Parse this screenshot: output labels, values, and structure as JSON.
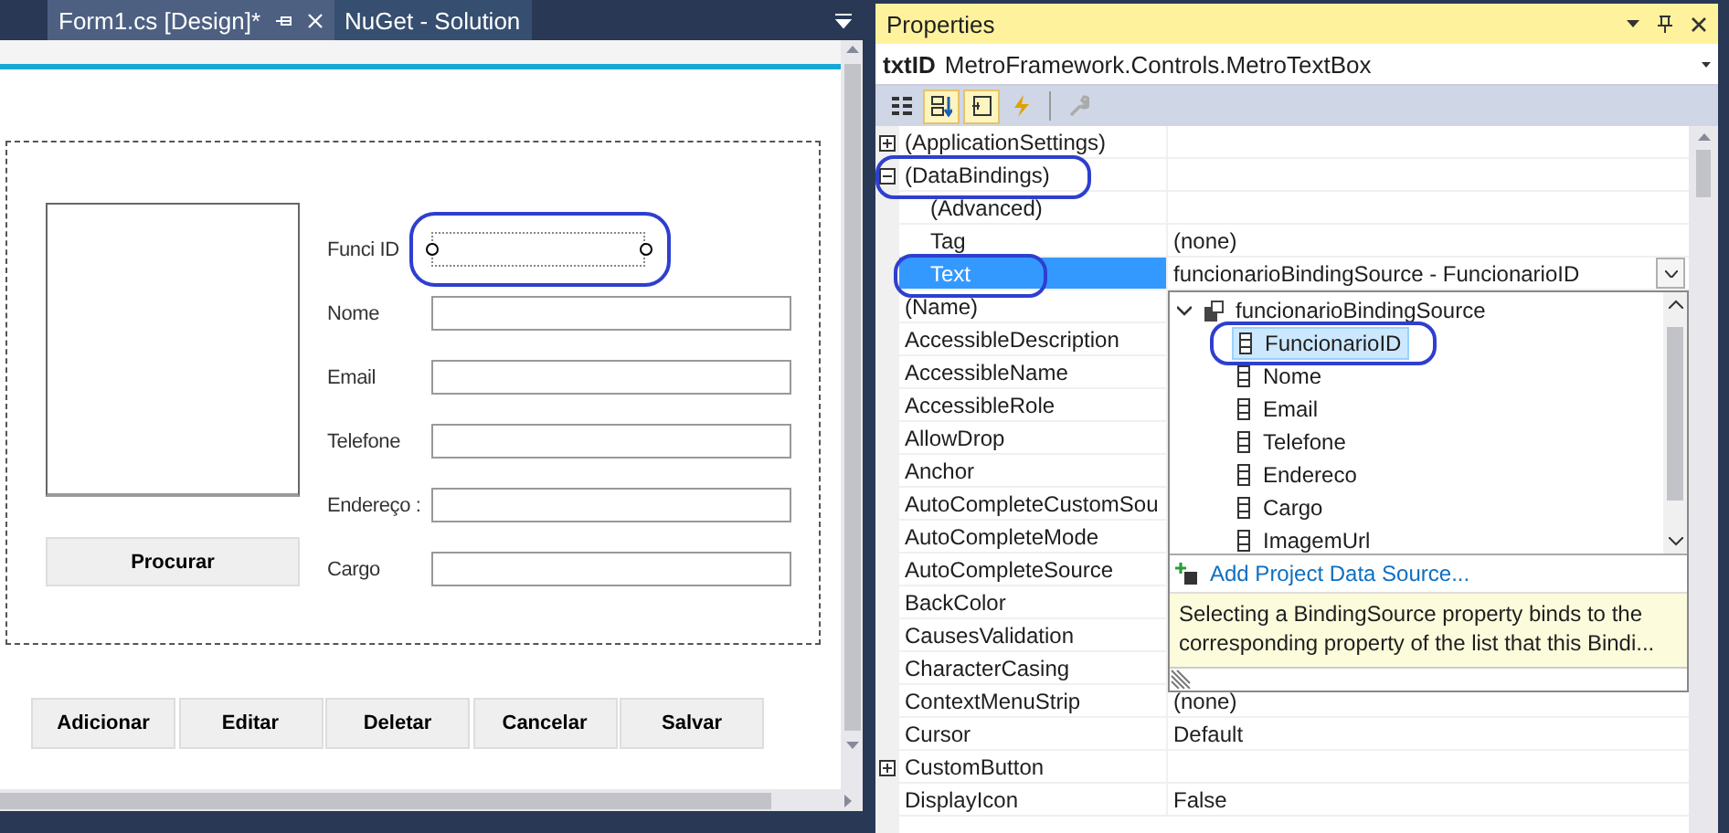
{
  "document_tabs": [
    {
      "label": "Form1.cs [Design]*",
      "selected": true
    },
    {
      "label": "NuGet - Solution",
      "selected": false
    }
  ],
  "form": {
    "search_button": "Procurar",
    "fields": [
      {
        "label": "Funci ID",
        "kind": "short",
        "selected": true,
        "highlighted": true
      },
      {
        "label": "Nome",
        "kind": "long",
        "selected": false,
        "highlighted": false
      },
      {
        "label": "Email",
        "kind": "long",
        "selected": false,
        "highlighted": false
      },
      {
        "label": "Telefone",
        "kind": "long",
        "selected": false,
        "highlighted": false
      },
      {
        "label": "Endereço :",
        "kind": "long",
        "selected": false,
        "highlighted": false
      },
      {
        "label": "Cargo",
        "kind": "long",
        "selected": false,
        "highlighted": false
      }
    ],
    "buttons": [
      "Adicionar",
      "Editar",
      "Deletar",
      "Cancelar",
      "Salvar"
    ]
  },
  "properties": {
    "title": "Properties",
    "object_name": "txtID",
    "object_type": "MetroFramework.Controls.MetroTextBox",
    "toolbar": [
      {
        "kind": "categorized",
        "selected": false
      },
      {
        "kind": "alphabetical",
        "selected": true
      },
      {
        "kind": "properties",
        "selected": true
      },
      {
        "kind": "events",
        "selected": false
      },
      {
        "kind": "pages",
        "selected": false
      }
    ],
    "rows": [
      {
        "name": "(ApplicationSettings)",
        "expanded": false,
        "selected": false,
        "highlighted": false
      },
      {
        "name": "(DataBindings)",
        "expanded": true,
        "selected": false,
        "highlighted": true,
        "children": [
          {
            "name": "(Advanced)",
            "selected": false,
            "highlighted": false
          },
          {
            "name": "Tag",
            "value": "(none)",
            "selected": false,
            "highlighted": false
          },
          {
            "name": "Text",
            "value": "funcionarioBindingSource - FuncionarioID",
            "selected": true,
            "highlighted": true
          }
        ]
      },
      {
        "name": "(Name)",
        "selected": false,
        "highlighted": false
      },
      {
        "name": "AccessibleDescription",
        "selected": false,
        "highlighted": false
      },
      {
        "name": "AccessibleName",
        "selected": false,
        "highlighted": false
      },
      {
        "name": "AccessibleRole",
        "selected": false,
        "highlighted": false
      },
      {
        "name": "AllowDrop",
        "selected": false,
        "highlighted": false
      },
      {
        "name": "Anchor",
        "selected": false,
        "highlighted": false
      },
      {
        "name": "AutoCompleteCustomSou",
        "selected": false,
        "highlighted": false
      },
      {
        "name": "AutoCompleteMode",
        "selected": false,
        "highlighted": false
      },
      {
        "name": "AutoCompleteSource",
        "selected": false,
        "highlighted": false
      },
      {
        "name": "BackColor",
        "selected": false,
        "highlighted": false
      },
      {
        "name": "CausesValidation",
        "selected": false,
        "highlighted": false
      },
      {
        "name": "CharacterCasing",
        "selected": false,
        "highlighted": false
      },
      {
        "name": "ContextMenuStrip",
        "value": "(none)",
        "selected": false,
        "highlighted": false
      },
      {
        "name": "Cursor",
        "value": "Default",
        "selected": false,
        "highlighted": false
      },
      {
        "name": "CustomButton",
        "expanded": false,
        "selected": false,
        "highlighted": false
      },
      {
        "name": "DisplayIcon",
        "value": "False",
        "selected": false,
        "highlighted": false
      }
    ],
    "binding_dropdown": {
      "source": {
        "label": "funcionarioBindingSource",
        "expanded": true,
        "children": [
          {
            "label": "FuncionarioID",
            "selected": true,
            "highlighted": true
          },
          {
            "label": "Nome",
            "selected": false,
            "highlighted": false
          },
          {
            "label": "Email",
            "selected": false,
            "highlighted": false
          },
          {
            "label": "Telefone",
            "selected": false,
            "highlighted": false
          },
          {
            "label": "Endereco",
            "selected": false,
            "highlighted": false
          },
          {
            "label": "Cargo",
            "selected": false,
            "highlighted": false
          },
          {
            "label": "ImagemUrl",
            "selected": false,
            "highlighted": false
          }
        ]
      },
      "link": "Add Project Data Source...",
      "description": "Selecting a BindingSource property binds to the corresponding property of the list that this Bindi..."
    }
  }
}
